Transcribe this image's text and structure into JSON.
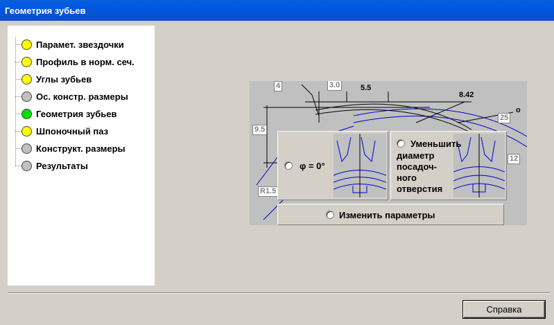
{
  "window": {
    "title": "Геометрия зубьев"
  },
  "tree": {
    "items": [
      {
        "label": "Парамет. звездочки",
        "color": "#ffff00"
      },
      {
        "label": "Профиль в норм. сеч.",
        "color": "#ffff00"
      },
      {
        "label": "Углы зубьев",
        "color": "#ffff00"
      },
      {
        "label": "Ос. констр. размеры",
        "color": "#c0c0c0"
      },
      {
        "label": "Геометрия зубьев",
        "color": "#00e000"
      },
      {
        "label": "Шпоночный паз",
        "color": "#ffff00"
      },
      {
        "label": "Конструкт. размеры",
        "color": "#c0c0c0"
      },
      {
        "label": "Результаты",
        "color": "#c0c0c0"
      }
    ]
  },
  "diagram": {
    "dims": {
      "d4": "4",
      "d30": "3.0",
      "d55": "5.5",
      "d842": "8.42",
      "d25": "25",
      "d95": "9.5",
      "d12": "12",
      "r15": "R1.5",
      "deg": "о"
    }
  },
  "options": {
    "phi_label": "φ = 0°",
    "reduce_label": "Уменьшить",
    "reduce_text": [
      "диаметр",
      "посадоч-",
      "ного",
      "отверстия"
    ],
    "change_label": "Изменить параметры"
  },
  "buttons": {
    "help": "Справка"
  }
}
